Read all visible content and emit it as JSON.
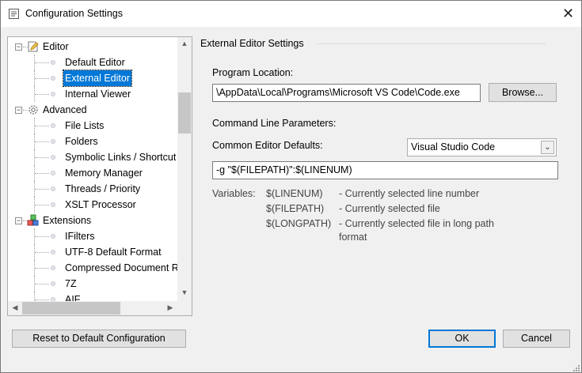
{
  "window": {
    "title": "Configuration Settings",
    "close_glyph": "✕"
  },
  "tree": {
    "items": [
      {
        "label": "Editor",
        "level": 0,
        "expanded": true,
        "icon": "pencil-page-icon"
      },
      {
        "label": "Default Editor",
        "level": 1
      },
      {
        "label": "External Editor",
        "level": 1,
        "selected": true
      },
      {
        "label": "Internal Viewer",
        "level": 1
      },
      {
        "label": "Advanced",
        "level": 0,
        "expanded": true,
        "icon": "gear-icon"
      },
      {
        "label": "File Lists",
        "level": 1
      },
      {
        "label": "Folders",
        "level": 1
      },
      {
        "label": "Symbolic Links / Shortcut",
        "level": 1
      },
      {
        "label": "Memory Manager",
        "level": 1
      },
      {
        "label": "Threads / Priority",
        "level": 1
      },
      {
        "label": "XSLT Processor",
        "level": 1
      },
      {
        "label": "Extensions",
        "level": 0,
        "expanded": true,
        "icon": "blocks-icon"
      },
      {
        "label": "IFilters",
        "level": 1
      },
      {
        "label": "UTF-8 Default Format",
        "level": 1
      },
      {
        "label": "Compressed Document R",
        "level": 1
      },
      {
        "label": "7Z",
        "level": 1
      },
      {
        "label": "AIF",
        "level": 1
      }
    ],
    "expand_glyph": "−",
    "scroll_up": "▲",
    "scroll_down": "▼",
    "scroll_left": "◀",
    "scroll_right": "▶"
  },
  "section": {
    "title": "External Editor Settings",
    "program_location_label": "Program Location:",
    "program_location_value": "\\AppData\\Local\\Programs\\Microsoft VS Code\\Code.exe",
    "browse_label": "Browse...",
    "cmd_params_label": "Command Line Parameters:",
    "common_defaults_label": "Common Editor Defaults:",
    "common_defaults_value": "Visual Studio Code",
    "dropdown_glyph": "⌄",
    "params_value": "-g \"$(FILEPATH)\":$(LINENUM)",
    "variables_label": "Variables:",
    "variables": [
      {
        "name": "$(LINENUM)",
        "desc": "- Currently selected line number"
      },
      {
        "name": "$(FILEPATH)",
        "desc": "- Currently selected file"
      },
      {
        "name": "$(LONGPATH)",
        "desc": "- Currently selected file in long path"
      }
    ],
    "longpath_desc_cont": "format"
  },
  "footer": {
    "reset_label": "Reset to Default Configuration",
    "ok_label": "OK",
    "cancel_label": "Cancel"
  },
  "colors": {
    "selection": "#0078d7",
    "button_face": "#e1e1e1"
  }
}
